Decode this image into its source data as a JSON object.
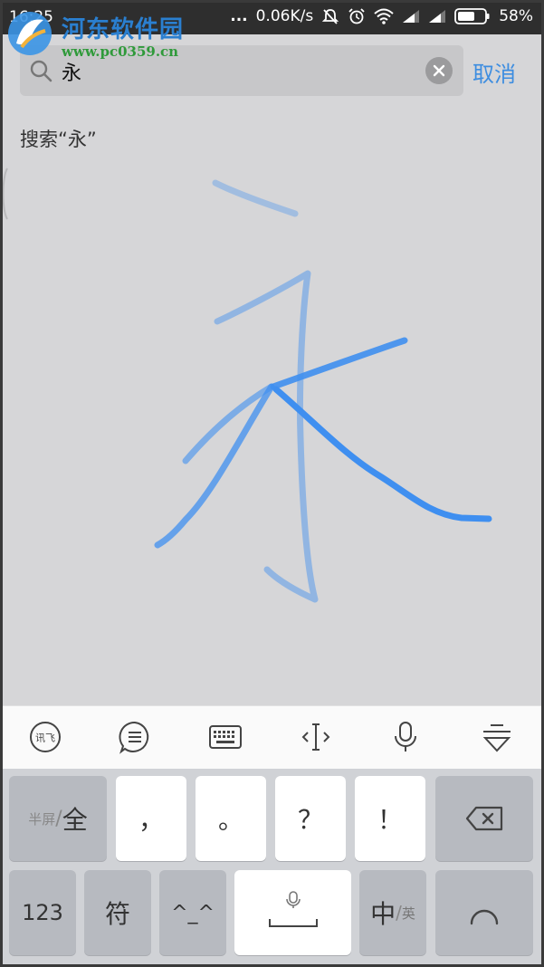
{
  "status_bar": {
    "time": "16:25",
    "dots": "...",
    "speed": "0.06K/s",
    "battery": "58%",
    "icons": [
      "mute-icon",
      "alarm-icon",
      "wifi-icon",
      "signal-icon",
      "signal-icon",
      "battery-icon"
    ]
  },
  "watermark": {
    "title": "河东软件园",
    "url": "www.pc0359.cn"
  },
  "search": {
    "query": "永",
    "cancel_label": "取消"
  },
  "suggestion": {
    "text": "搜索“永”"
  },
  "handwriting": {
    "character": "永",
    "stroke_color": "#3f8ff0"
  },
  "toolbar": {
    "items": [
      {
        "name": "xunfei-logo-icon",
        "label": "讯飞"
      },
      {
        "name": "emoji-list-icon"
      },
      {
        "name": "keyboard-icon"
      },
      {
        "name": "cursor-move-icon"
      },
      {
        "name": "microphone-icon"
      },
      {
        "name": "collapse-keyboard-icon"
      }
    ]
  },
  "keyboard": {
    "row1": {
      "half_full": {
        "sub": "半屏",
        "main": "全"
      },
      "comma": "，",
      "period": "。",
      "question": "？",
      "exclaim": "！"
    },
    "row2": {
      "num": "123",
      "symbol": "符",
      "emoticon": "^_^",
      "lang": {
        "main": "中",
        "sub": "英"
      }
    }
  },
  "colors": {
    "accent": "#3d8de0",
    "stroke": "#3f8ff0",
    "background": "#d6d6d8",
    "keyboard_bg": "#d0d2d6"
  }
}
